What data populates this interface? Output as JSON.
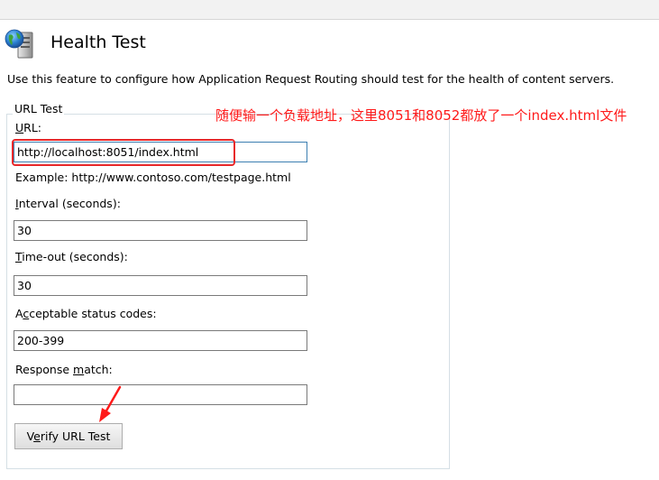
{
  "page": {
    "title": "Health Test",
    "description": "Use this feature to configure how Application Request Routing should test for the health of content servers."
  },
  "url_test": {
    "legend": "URL Test",
    "url": {
      "label_key": "U",
      "label_rest": "RL:",
      "value": "http://localhost:8051/index.html"
    },
    "example": "Example: http://www.contoso.com/testpage.html",
    "interval": {
      "label_key": "I",
      "label_rest": "nterval (seconds):",
      "value": "30"
    },
    "timeout": {
      "label_key": "T",
      "label_rest": "ime-out (seconds):",
      "value": "30"
    },
    "status_codes": {
      "label_pre": "A",
      "label_key": "c",
      "label_rest": "ceptable status codes:",
      "value": "200-399"
    },
    "response_match": {
      "label_pre": "Response ",
      "label_key": "m",
      "label_rest": "atch:",
      "value": ""
    },
    "verify_button": {
      "label_pre": "V",
      "label_key": "e",
      "label_rest": "rify URL Test"
    }
  },
  "annotation": {
    "text": "随便输一个负载地址，这里8051和8052都放了一个index.html文件",
    "color": "#ff1a1a"
  },
  "icons": {
    "title_icon": "server-globe-icon",
    "arrow": "red-arrow-icon"
  }
}
